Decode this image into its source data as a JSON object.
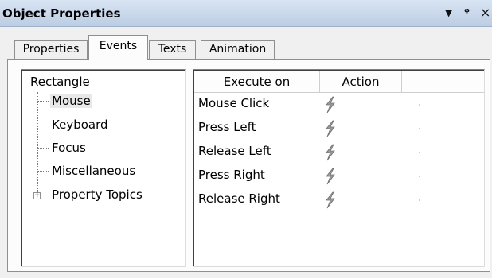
{
  "window": {
    "title": "Object Properties",
    "menu_glyph": "▼",
    "pin_glyph": "ᵠ",
    "close_glyph": "×"
  },
  "tabs": [
    {
      "label": "Properties",
      "selected": false
    },
    {
      "label": "Events",
      "selected": true
    },
    {
      "label": "Texts",
      "selected": false
    },
    {
      "label": "Animation",
      "selected": false
    }
  ],
  "tree": {
    "root": "Rectangle",
    "items": [
      {
        "label": "Mouse",
        "selected": true
      },
      {
        "label": "Keyboard",
        "selected": false
      },
      {
        "label": "Focus",
        "selected": false
      },
      {
        "label": "Miscellaneous",
        "selected": false
      },
      {
        "label": "Property Topics",
        "expandable": true,
        "expander": "+"
      }
    ]
  },
  "grid": {
    "columns": [
      "Execute on",
      "Action",
      ""
    ],
    "rows": [
      {
        "execute_on": "Mouse Click",
        "action_icon": "lightning-bolt-icon"
      },
      {
        "execute_on": "Press Left",
        "action_icon": "lightning-bolt-icon"
      },
      {
        "execute_on": "Release Left",
        "action_icon": "lightning-bolt-icon"
      },
      {
        "execute_on": "Press Right",
        "action_icon": "lightning-bolt-icon"
      },
      {
        "execute_on": "Release Right",
        "action_icon": "lightning-bolt-icon"
      }
    ]
  },
  "colors": {
    "titlebar": "#c6d5ea",
    "panel": "#fcfcfc",
    "selection": "#e8e8e8",
    "bolt": "#8a8a8a"
  }
}
